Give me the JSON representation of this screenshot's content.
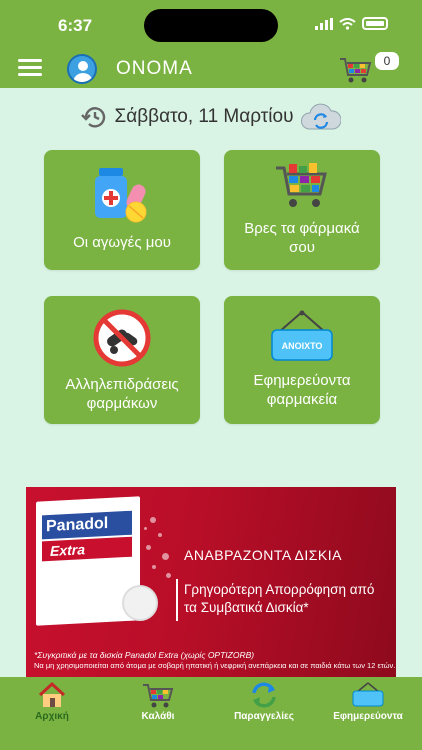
{
  "status_bar": {
    "time": "6:37"
  },
  "app_bar": {
    "title": "ONOMA",
    "cart_count": "0"
  },
  "date": "Σάββατο, 11 Μαρτίου",
  "tiles": [
    {
      "label": "Οι αγωγές μου",
      "icon": "medicine-bottle-pills-icon"
    },
    {
      "label": "Βρες τα φάρμακά σου",
      "icon": "shopping-cart-icon"
    },
    {
      "label": "Αλληλεπιδράσεις φαρμάκων",
      "icon": "no-pills-icon"
    },
    {
      "label": "Εφημερεύοντα φαρμακεία",
      "icon": "open-sign-icon",
      "sign_text": "ΑΝΟΙΧΤΟ"
    }
  ],
  "ad": {
    "brand": "Panadol",
    "product": "Extra",
    "headline": "ΑΝΑΒΡΑΖΟΝΤΑ ΔΙΣΚΙΑ",
    "body": "Γρηγορότερη Απορρόφηση από τα Συμβατικά Δισκία*",
    "footnote": "*Συγκριτικά με τα δισκία Panadol Extra (χωρίς OPTIZORB)",
    "disclaimer": "Να μη χρησιμοποιείται από άτομα με σοβαρή ηπατική ή νεφρική ανεπάρκεια και σε παιδιά κάτω των 12 ετών."
  },
  "tabs": [
    {
      "label": "Αρχική",
      "icon": "home-icon",
      "active": true
    },
    {
      "label": "Καλάθι",
      "icon": "cart-icon",
      "active": false
    },
    {
      "label": "Παραγγελίες",
      "icon": "refresh-icon",
      "active": false
    },
    {
      "label": "Εφημερεύοντα",
      "icon": "open-sign-icon",
      "active": false
    }
  ],
  "colors": {
    "primary_green": "#7bb342",
    "background": "#d9f3e4",
    "ad_red": "#c8102e"
  }
}
